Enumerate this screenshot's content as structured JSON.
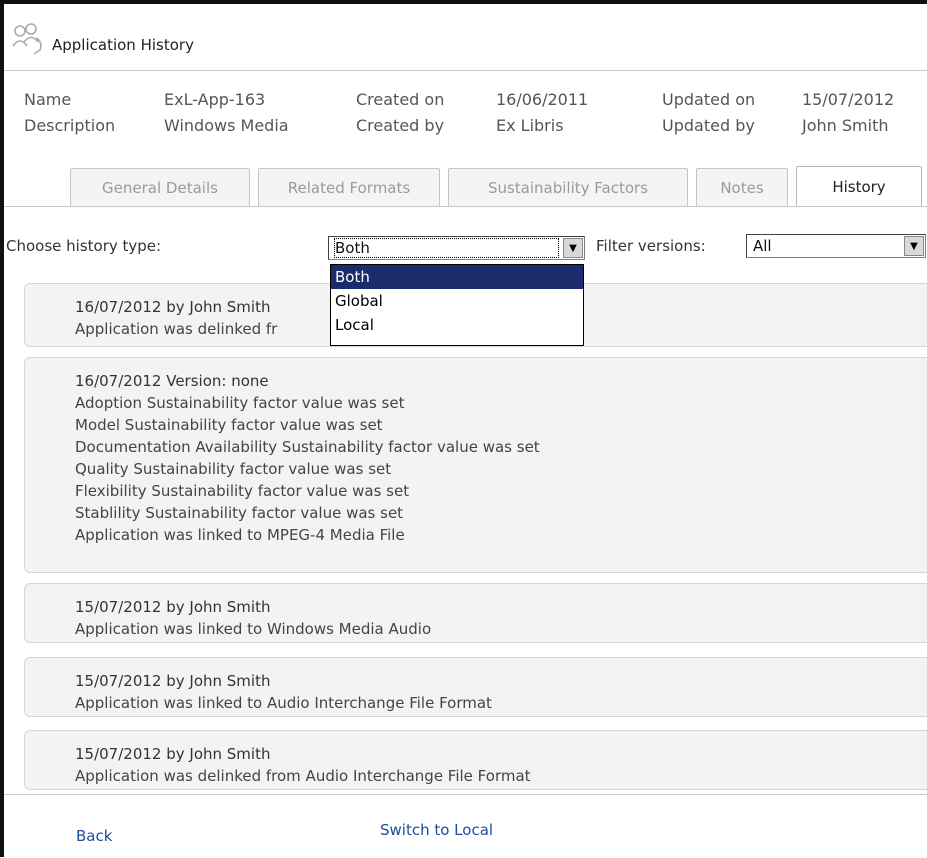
{
  "window": {
    "title": "Application History"
  },
  "meta": {
    "name_label": "Name",
    "name_value": "ExL-App-163",
    "description_label": "Description",
    "description_value": "Windows Media",
    "created_on_label": "Created on",
    "created_on_value": "16/06/2011",
    "created_by_label": "Created by",
    "created_by_value": "Ex Libris",
    "updated_on_label": "Updated on",
    "updated_on_value": "15/07/2012",
    "updated_by_label": "Updated by",
    "updated_by_value": "John Smith"
  },
  "tabs": [
    {
      "label": "General Details"
    },
    {
      "label": "Related Formats"
    },
    {
      "label": "Sustainability Factors"
    },
    {
      "label": "Notes"
    },
    {
      "label": "History"
    }
  ],
  "controls": {
    "history_type_label": "Choose history type:",
    "history_type_value": "Both",
    "history_type_options": [
      "Both",
      "Global",
      "Local"
    ],
    "filter_label": "Filter versions:",
    "filter_value": "All"
  },
  "entries": [
    {
      "lines": [
        "16/07/2012 by John Smith",
        "Application was delinked fr"
      ]
    },
    {
      "lines": [
        "16/07/2012 Version: none",
        "Adoption Sustainability factor value was set",
        "Model Sustainability factor value was set",
        "Documentation Availability Sustainability factor value was set",
        "Quality Sustainability factor value was set",
        "Flexibility Sustainability factor value was set",
        "Stablility Sustainability factor value was set",
        "Application was linked to MPEG-4 Media File"
      ]
    },
    {
      "lines": [
        "15/07/2012 by John Smith",
        "Application was linked to Windows Media Audio"
      ]
    },
    {
      "lines": [
        "15/07/2012 by John Smith",
        "Application was linked to Audio Interchange File Format"
      ]
    },
    {
      "lines": [
        "15/07/2012 by John Smith",
        "Application was delinked from Audio Interchange File Format"
      ]
    }
  ],
  "footer": {
    "back_label": "Back",
    "switch_label": "Switch to Local"
  },
  "colors": {
    "accent": "#1b2b6b",
    "link": "#1b4d9e"
  },
  "icons": {
    "app": "users-icon",
    "dropdown_arrow": "chevron-down-icon"
  }
}
